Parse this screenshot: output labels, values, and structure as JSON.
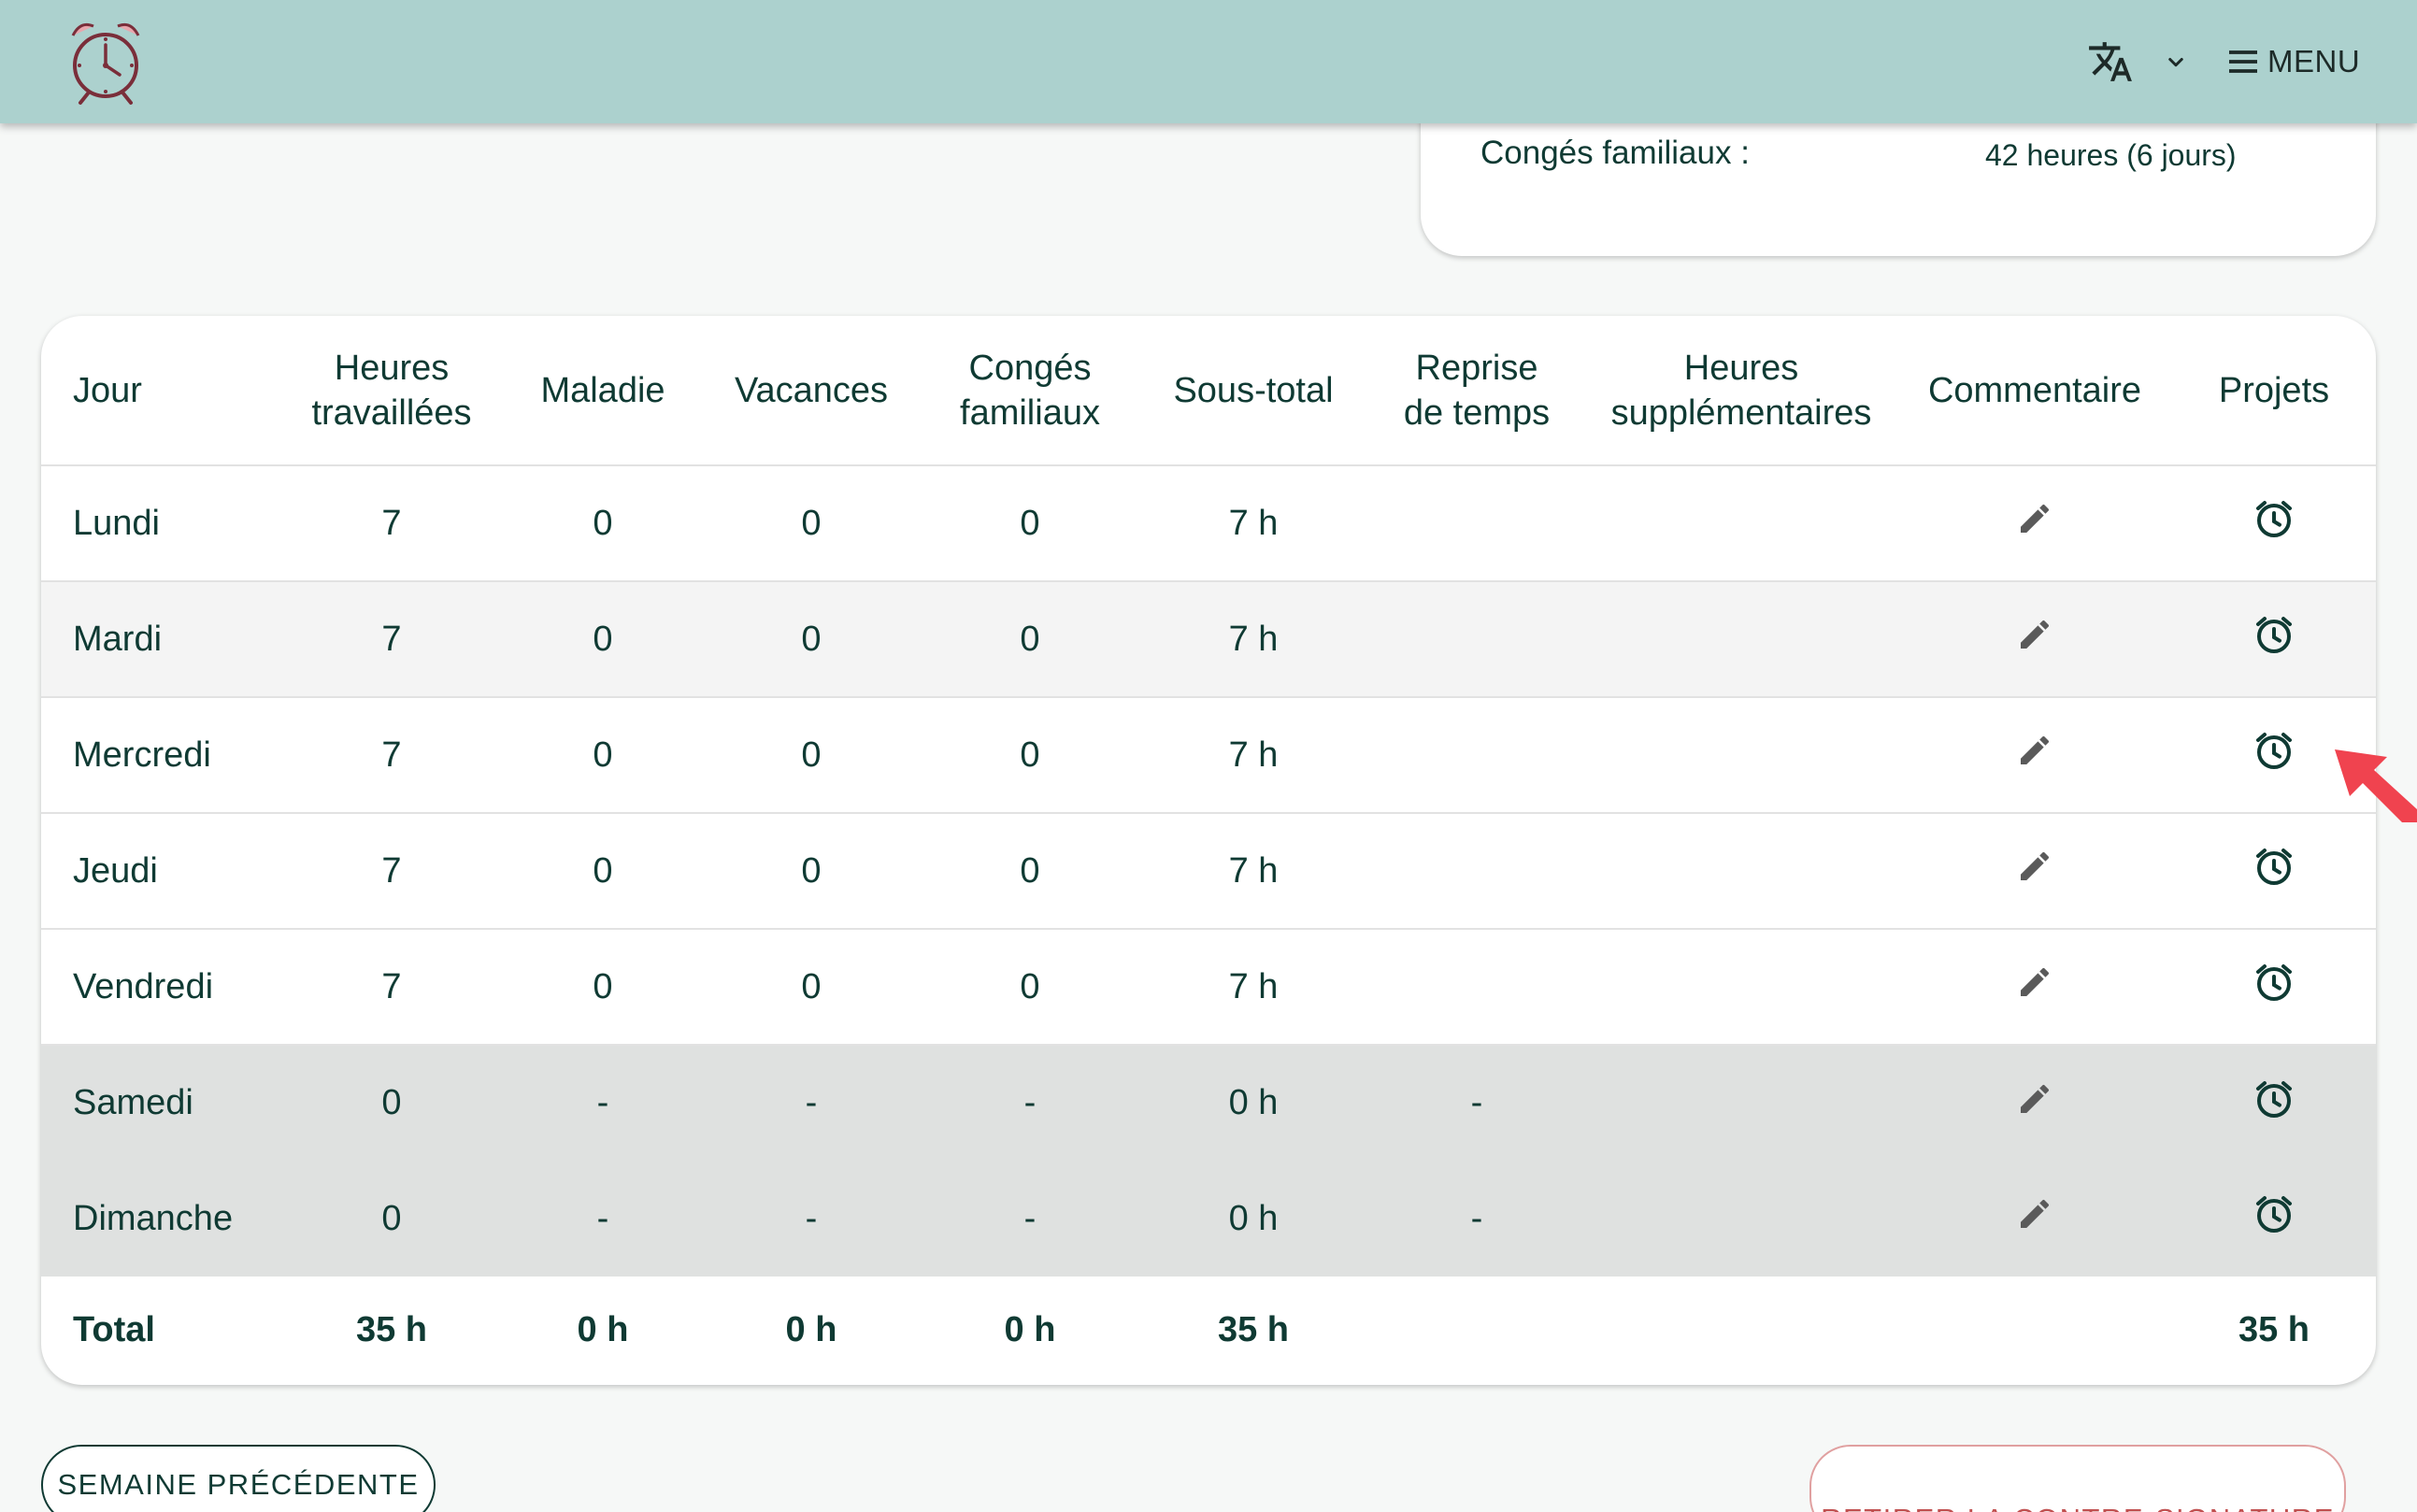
{
  "header": {
    "logo_icon": "alarm-clock-logo-icon",
    "language_icon": "translate-icon",
    "caret_icon": "chevron-down-icon",
    "menu_icon": "hamburger-icon",
    "menu_label": "MENU",
    "color": "#acd1ce"
  },
  "summary": {
    "label": "Congés familiaux :",
    "value": "42 heures (6 jours)"
  },
  "table": {
    "headers": {
      "day_label": "Jour",
      "worked_line1": "Heures",
      "worked_line2": "travaillées",
      "sick_label": "Maladie",
      "vacation_label": "Vacances",
      "family_line1": "Congés",
      "family_line2": "familiaux",
      "subtotal_label": "Sous-total",
      "reprise_line1": "Reprise",
      "reprise_line2": "de temps",
      "overtime_line1": "Heures",
      "overtime_line2": "supplémentaires",
      "comment_label": "Commentaire",
      "projects_label": "Projets"
    },
    "rows": [
      {
        "day": "Lundi",
        "worked": "7",
        "sick": "0",
        "vacation": "0",
        "family": "0",
        "subtotal": "7 h",
        "reprise": "",
        "overtime": ""
      },
      {
        "day": "Mardi",
        "worked": "7",
        "sick": "0",
        "vacation": "0",
        "family": "0",
        "subtotal": "7 h",
        "reprise": "",
        "overtime": ""
      },
      {
        "day": "Mercredi",
        "worked": "7",
        "sick": "0",
        "vacation": "0",
        "family": "0",
        "subtotal": "7 h",
        "reprise": "",
        "overtime": ""
      },
      {
        "day": "Jeudi",
        "worked": "7",
        "sick": "0",
        "vacation": "0",
        "family": "0",
        "subtotal": "7 h",
        "reprise": "",
        "overtime": ""
      },
      {
        "day": "Vendredi",
        "worked": "7",
        "sick": "0",
        "vacation": "0",
        "family": "0",
        "subtotal": "7 h",
        "reprise": "",
        "overtime": ""
      },
      {
        "day": "Samedi",
        "worked": "0",
        "sick": "-",
        "vacation": "-",
        "family": "-",
        "subtotal": "0 h",
        "reprise": "-",
        "overtime": ""
      },
      {
        "day": "Dimanche",
        "worked": "0",
        "sick": "-",
        "vacation": "-",
        "family": "-",
        "subtotal": "0 h",
        "reprise": "-",
        "overtime": ""
      }
    ],
    "total": {
      "label": "Total",
      "worked": "35 h",
      "sick": "0 h",
      "vacation": "0 h",
      "family": "0 h",
      "subtotal": "35 h",
      "projects": "35 h"
    },
    "row_icons": {
      "comment": "pencil-edit-icon",
      "projects": "alarm-clock-icon"
    }
  },
  "buttons": {
    "previous_week": "SEMAINE PRÉCÉDENTE",
    "remove_signature": "RETIRER LA CONTRE-SIGNATURE"
  },
  "colors": {
    "text_primary": "#0f3a33",
    "weekend_row": "#dfe1e0",
    "alt_row": "#f4f4f4",
    "annotation_arrow": "#f0434f"
  }
}
